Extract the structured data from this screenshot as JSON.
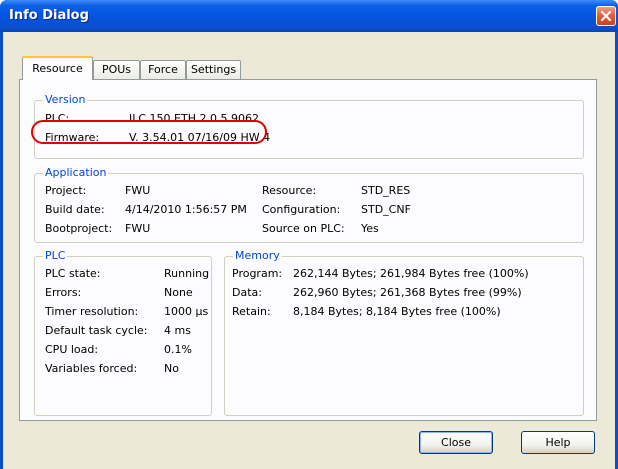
{
  "window": {
    "title": "Info Dialog"
  },
  "tabs": [
    {
      "label": "Resource",
      "active": true
    },
    {
      "label": "POUs",
      "active": false
    },
    {
      "label": "Force",
      "active": false
    },
    {
      "label": "Settings",
      "active": false
    }
  ],
  "version": {
    "title": "Version",
    "plc_label": "PLC:",
    "plc_value": "ILC 150 ETH 2.0.5.9062",
    "firmware_label": "Firmware:",
    "firmware_value": "V. 3.54.01  07/16/09 HW 4"
  },
  "application": {
    "title": "Application",
    "project_label": "Project:",
    "project_value": "FWU",
    "build_date_label": "Build date:",
    "build_date_value": "4/14/2010 1:56:57 PM",
    "bootproject_label": "Bootproject:",
    "bootproject_value": "FWU",
    "resource_label": "Resource:",
    "resource_value": "STD_RES",
    "configuration_label": "Configuration:",
    "configuration_value": "STD_CNF",
    "source_label": "Source on PLC:",
    "source_value": "Yes"
  },
  "plc": {
    "title": "PLC",
    "rows": [
      {
        "label": "PLC state:",
        "value": "Running"
      },
      {
        "label": "Errors:",
        "value": "None"
      },
      {
        "label": "Timer resolution:",
        "value": "1000 µs"
      },
      {
        "label": "Default task cycle:",
        "value": "4 ms"
      },
      {
        "label": "CPU load:",
        "value": "0.1%"
      },
      {
        "label": "Variables forced:",
        "value": "No"
      }
    ]
  },
  "memory": {
    "title": "Memory",
    "rows": [
      {
        "label": "Program:",
        "value": "262,144 Bytes;  261,984 Bytes free (100%)"
      },
      {
        "label": "Data:",
        "value": "262,960 Bytes;  261,368 Bytes free (99%)"
      },
      {
        "label": "Retain:",
        "value": "8,184 Bytes;  8,184 Bytes free (100%)"
      }
    ]
  },
  "buttons": {
    "close": "Close",
    "help": "Help"
  },
  "colors": {
    "highlight": "#e00000",
    "group_title": "#0046d5",
    "titlebar": "#0554e0"
  }
}
